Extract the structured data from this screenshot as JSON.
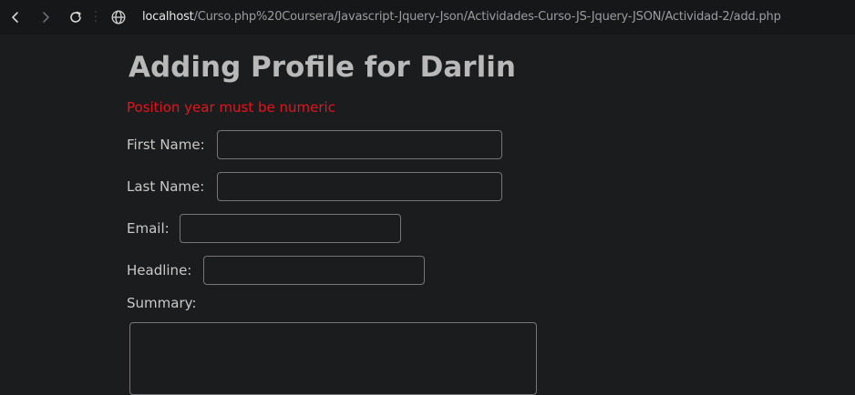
{
  "browser": {
    "back_icon": "chevron-left-icon",
    "forward_icon": "chevron-right-icon",
    "reload_icon": "reload-icon",
    "site_info_icon": "globe-icon",
    "url_host": "localhost",
    "url_path": "/Curso.php%20Coursera/Javascript-Jquery-Json/Actividades-Curso-JS-Jquery-JSON/Actividad-2/add.php"
  },
  "page": {
    "title": "Adding Profile for Darlin",
    "error_message": "Position year must be numeric",
    "error_color": "#e4141b"
  },
  "form": {
    "first_name": {
      "label": "First Name:",
      "value": ""
    },
    "last_name": {
      "label": "Last Name:",
      "value": ""
    },
    "email": {
      "label": "Email:",
      "value": ""
    },
    "headline": {
      "label": "Headline:",
      "value": ""
    },
    "summary": {
      "label": "Summary:",
      "value": ""
    }
  }
}
